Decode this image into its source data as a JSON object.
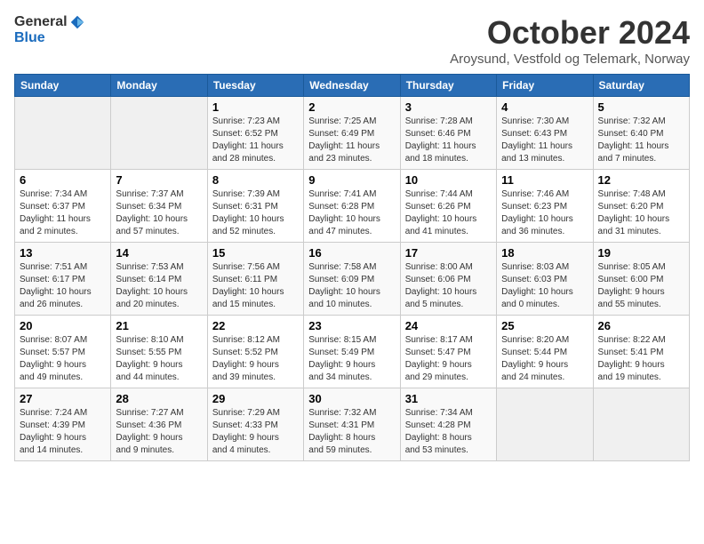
{
  "header": {
    "logo_line1": "General",
    "logo_line2": "Blue",
    "month_title": "October 2024",
    "subtitle": "Aroysund, Vestfold og Telemark, Norway"
  },
  "weekdays": [
    "Sunday",
    "Monday",
    "Tuesday",
    "Wednesday",
    "Thursday",
    "Friday",
    "Saturday"
  ],
  "rows": [
    [
      {
        "day": "",
        "info": ""
      },
      {
        "day": "",
        "info": ""
      },
      {
        "day": "1",
        "info": "Sunrise: 7:23 AM\nSunset: 6:52 PM\nDaylight: 11 hours\nand 28 minutes."
      },
      {
        "day": "2",
        "info": "Sunrise: 7:25 AM\nSunset: 6:49 PM\nDaylight: 11 hours\nand 23 minutes."
      },
      {
        "day": "3",
        "info": "Sunrise: 7:28 AM\nSunset: 6:46 PM\nDaylight: 11 hours\nand 18 minutes."
      },
      {
        "day": "4",
        "info": "Sunrise: 7:30 AM\nSunset: 6:43 PM\nDaylight: 11 hours\nand 13 minutes."
      },
      {
        "day": "5",
        "info": "Sunrise: 7:32 AM\nSunset: 6:40 PM\nDaylight: 11 hours\nand 7 minutes."
      }
    ],
    [
      {
        "day": "6",
        "info": "Sunrise: 7:34 AM\nSunset: 6:37 PM\nDaylight: 11 hours\nand 2 minutes."
      },
      {
        "day": "7",
        "info": "Sunrise: 7:37 AM\nSunset: 6:34 PM\nDaylight: 10 hours\nand 57 minutes."
      },
      {
        "day": "8",
        "info": "Sunrise: 7:39 AM\nSunset: 6:31 PM\nDaylight: 10 hours\nand 52 minutes."
      },
      {
        "day": "9",
        "info": "Sunrise: 7:41 AM\nSunset: 6:28 PM\nDaylight: 10 hours\nand 47 minutes."
      },
      {
        "day": "10",
        "info": "Sunrise: 7:44 AM\nSunset: 6:26 PM\nDaylight: 10 hours\nand 41 minutes."
      },
      {
        "day": "11",
        "info": "Sunrise: 7:46 AM\nSunset: 6:23 PM\nDaylight: 10 hours\nand 36 minutes."
      },
      {
        "day": "12",
        "info": "Sunrise: 7:48 AM\nSunset: 6:20 PM\nDaylight: 10 hours\nand 31 minutes."
      }
    ],
    [
      {
        "day": "13",
        "info": "Sunrise: 7:51 AM\nSunset: 6:17 PM\nDaylight: 10 hours\nand 26 minutes."
      },
      {
        "day": "14",
        "info": "Sunrise: 7:53 AM\nSunset: 6:14 PM\nDaylight: 10 hours\nand 20 minutes."
      },
      {
        "day": "15",
        "info": "Sunrise: 7:56 AM\nSunset: 6:11 PM\nDaylight: 10 hours\nand 15 minutes."
      },
      {
        "day": "16",
        "info": "Sunrise: 7:58 AM\nSunset: 6:09 PM\nDaylight: 10 hours\nand 10 minutes."
      },
      {
        "day": "17",
        "info": "Sunrise: 8:00 AM\nSunset: 6:06 PM\nDaylight: 10 hours\nand 5 minutes."
      },
      {
        "day": "18",
        "info": "Sunrise: 8:03 AM\nSunset: 6:03 PM\nDaylight: 10 hours\nand 0 minutes."
      },
      {
        "day": "19",
        "info": "Sunrise: 8:05 AM\nSunset: 6:00 PM\nDaylight: 9 hours\nand 55 minutes."
      }
    ],
    [
      {
        "day": "20",
        "info": "Sunrise: 8:07 AM\nSunset: 5:57 PM\nDaylight: 9 hours\nand 49 minutes."
      },
      {
        "day": "21",
        "info": "Sunrise: 8:10 AM\nSunset: 5:55 PM\nDaylight: 9 hours\nand 44 minutes."
      },
      {
        "day": "22",
        "info": "Sunrise: 8:12 AM\nSunset: 5:52 PM\nDaylight: 9 hours\nand 39 minutes."
      },
      {
        "day": "23",
        "info": "Sunrise: 8:15 AM\nSunset: 5:49 PM\nDaylight: 9 hours\nand 34 minutes."
      },
      {
        "day": "24",
        "info": "Sunrise: 8:17 AM\nSunset: 5:47 PM\nDaylight: 9 hours\nand 29 minutes."
      },
      {
        "day": "25",
        "info": "Sunrise: 8:20 AM\nSunset: 5:44 PM\nDaylight: 9 hours\nand 24 minutes."
      },
      {
        "day": "26",
        "info": "Sunrise: 8:22 AM\nSunset: 5:41 PM\nDaylight: 9 hours\nand 19 minutes."
      }
    ],
    [
      {
        "day": "27",
        "info": "Sunrise: 7:24 AM\nSunset: 4:39 PM\nDaylight: 9 hours\nand 14 minutes."
      },
      {
        "day": "28",
        "info": "Sunrise: 7:27 AM\nSunset: 4:36 PM\nDaylight: 9 hours\nand 9 minutes."
      },
      {
        "day": "29",
        "info": "Sunrise: 7:29 AM\nSunset: 4:33 PM\nDaylight: 9 hours\nand 4 minutes."
      },
      {
        "day": "30",
        "info": "Sunrise: 7:32 AM\nSunset: 4:31 PM\nDaylight: 8 hours\nand 59 minutes."
      },
      {
        "day": "31",
        "info": "Sunrise: 7:34 AM\nSunset: 4:28 PM\nDaylight: 8 hours\nand 53 minutes."
      },
      {
        "day": "",
        "info": ""
      },
      {
        "day": "",
        "info": ""
      }
    ]
  ]
}
